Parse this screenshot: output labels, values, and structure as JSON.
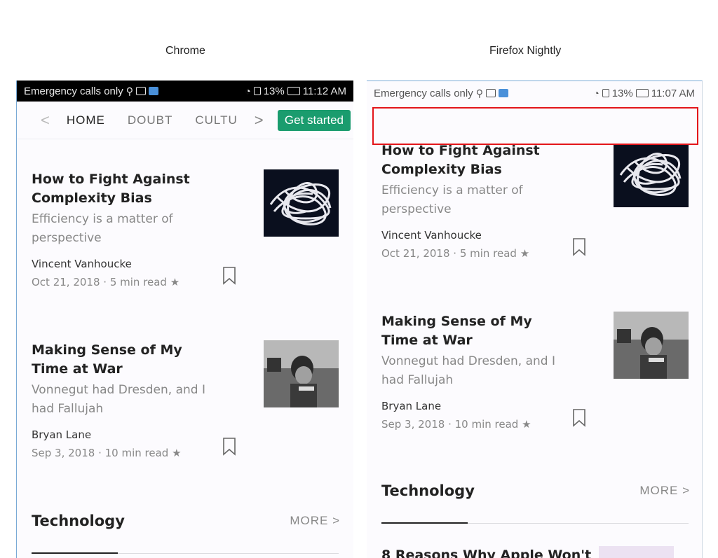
{
  "captions": {
    "left": "Chrome",
    "right": "Firefox Nightly"
  },
  "status": {
    "left_text": "Emergency calls only",
    "chrome_battery": "13%",
    "chrome_time": "11:12 AM",
    "firefox_battery": "13%",
    "firefox_time": "11:07 AM"
  },
  "nav": {
    "tabs": [
      {
        "label": "HOME"
      },
      {
        "label": "DOUBT"
      },
      {
        "label": "CULTU"
      }
    ],
    "cta": "Get started"
  },
  "articles": [
    {
      "title": "How to Fight Against Complexity Bias",
      "subtitle": "Efficiency is a matter of perspective",
      "author": "Vincent Vanhoucke",
      "date": "Oct 21, 2018",
      "read": "5 min read",
      "star": "★",
      "thumb": "tangled-wire-image"
    },
    {
      "title": "Making Sense of My Time at War",
      "subtitle": "Vonnegut had Dresden, and I had Fallujah",
      "author": "Bryan Lane",
      "date": "Sep 3, 2018",
      "read": "10 min read",
      "star": "★",
      "thumb": "soldier-photo"
    }
  ],
  "section": {
    "title": "Technology",
    "more": "MORE >"
  },
  "next_article": {
    "title": "8 Reasons Why Apple Won't"
  },
  "colors": {
    "accent_green": "#1a9c6e",
    "highlight_red": "#e3151a",
    "status_black": "#000000"
  }
}
